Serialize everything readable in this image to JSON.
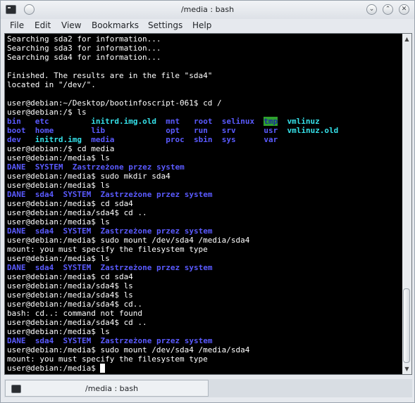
{
  "window": {
    "title": "/media : bash"
  },
  "menu": [
    "File",
    "Edit",
    "View",
    "Bookmarks",
    "Settings",
    "Help"
  ],
  "tab": {
    "label": "/media : bash"
  },
  "terminal": {
    "lines": [
      [
        {
          "t": "Searching sda2 for information..."
        }
      ],
      [
        {
          "t": "Searching sda3 for information..."
        }
      ],
      [
        {
          "t": "Searching sda4 for information..."
        }
      ],
      [
        {
          "t": ""
        }
      ],
      [
        {
          "t": "Finished. The results are in the file \"sda4\""
        }
      ],
      [
        {
          "t": "located in \"/dev/\"."
        }
      ],
      [
        {
          "t": ""
        }
      ],
      [
        {
          "t": "user@debian:~/Desktop/bootinfoscript-061$ cd /"
        }
      ],
      [
        {
          "t": "user@debian:/$ ls"
        }
      ],
      [
        {
          "t": "bin",
          "c": "blue"
        },
        {
          "t": "   "
        },
        {
          "t": "etc",
          "c": "blue"
        },
        {
          "t": "         "
        },
        {
          "t": "initrd.img.old",
          "c": "cyan"
        },
        {
          "t": "  "
        },
        {
          "t": "mnt",
          "c": "blue"
        },
        {
          "t": "   "
        },
        {
          "t": "root",
          "c": "blue"
        },
        {
          "t": "  "
        },
        {
          "t": "selinux",
          "c": "blue"
        },
        {
          "t": "  "
        },
        {
          "t": "tmp",
          "c": "tmp"
        },
        {
          "t": "  "
        },
        {
          "t": "vmlinuz",
          "c": "cyan"
        }
      ],
      [
        {
          "t": "boot",
          "c": "blue"
        },
        {
          "t": "  "
        },
        {
          "t": "home",
          "c": "blue"
        },
        {
          "t": "        "
        },
        {
          "t": "lib",
          "c": "blue"
        },
        {
          "t": "             "
        },
        {
          "t": "opt",
          "c": "blue"
        },
        {
          "t": "   "
        },
        {
          "t": "run",
          "c": "blue"
        },
        {
          "t": "   "
        },
        {
          "t": "srv",
          "c": "blue"
        },
        {
          "t": "      "
        },
        {
          "t": "usr",
          "c": "blue"
        },
        {
          "t": "  "
        },
        {
          "t": "vmlinuz.old",
          "c": "cyan"
        }
      ],
      [
        {
          "t": "dev",
          "c": "blue"
        },
        {
          "t": "   "
        },
        {
          "t": "initrd.img",
          "c": "cyan"
        },
        {
          "t": "  "
        },
        {
          "t": "media",
          "c": "blue"
        },
        {
          "t": "           "
        },
        {
          "t": "proc",
          "c": "blue"
        },
        {
          "t": "  "
        },
        {
          "t": "sbin",
          "c": "blue"
        },
        {
          "t": "  "
        },
        {
          "t": "sys",
          "c": "blue"
        },
        {
          "t": "      "
        },
        {
          "t": "var",
          "c": "blue"
        }
      ],
      [
        {
          "t": "user@debian:/$ cd media"
        }
      ],
      [
        {
          "t": "user@debian:/media$ ls"
        }
      ],
      [
        {
          "t": "DANE",
          "c": "blue"
        },
        {
          "t": "  "
        },
        {
          "t": "SYSTEM",
          "c": "blue"
        },
        {
          "t": "  "
        },
        {
          "t": "Zastrzeżone przez system",
          "c": "blue"
        }
      ],
      [
        {
          "t": "user@debian:/media$ sudo mkdir sda4"
        }
      ],
      [
        {
          "t": "user@debian:/media$ ls"
        }
      ],
      [
        {
          "t": "DANE",
          "c": "blue"
        },
        {
          "t": "  "
        },
        {
          "t": "sda4",
          "c": "blue"
        },
        {
          "t": "  "
        },
        {
          "t": "SYSTEM",
          "c": "blue"
        },
        {
          "t": "  "
        },
        {
          "t": "Zastrzeżone przez system",
          "c": "blue"
        }
      ],
      [
        {
          "t": "user@debian:/media$ cd sda4"
        }
      ],
      [
        {
          "t": "user@debian:/media/sda4$ cd .."
        }
      ],
      [
        {
          "t": "user@debian:/media$ ls"
        }
      ],
      [
        {
          "t": "DANE",
          "c": "blue"
        },
        {
          "t": "  "
        },
        {
          "t": "sda4",
          "c": "blue"
        },
        {
          "t": "  "
        },
        {
          "t": "SYSTEM",
          "c": "blue"
        },
        {
          "t": "  "
        },
        {
          "t": "Zastrzeżone przez system",
          "c": "blue"
        }
      ],
      [
        {
          "t": "user@debian:/media$ sudo mount /dev/sda4 /media/sda4"
        }
      ],
      [
        {
          "t": "mount: you must specify the filesystem type"
        }
      ],
      [
        {
          "t": "user@debian:/media$ ls"
        }
      ],
      [
        {
          "t": "DANE",
          "c": "blue"
        },
        {
          "t": "  "
        },
        {
          "t": "sda4",
          "c": "blue"
        },
        {
          "t": "  "
        },
        {
          "t": "SYSTEM",
          "c": "blue"
        },
        {
          "t": "  "
        },
        {
          "t": "Zastrzeżone przez system",
          "c": "blue"
        }
      ],
      [
        {
          "t": "user@debian:/media$ cd sda4"
        }
      ],
      [
        {
          "t": "user@debian:/media/sda4$ ls"
        }
      ],
      [
        {
          "t": "user@debian:/media/sda4$ ls"
        }
      ],
      [
        {
          "t": "user@debian:/media/sda4$ cd.."
        }
      ],
      [
        {
          "t": "bash: cd..: command not found"
        }
      ],
      [
        {
          "t": "user@debian:/media/sda4$ cd .."
        }
      ],
      [
        {
          "t": "user@debian:/media$ ls"
        }
      ],
      [
        {
          "t": "DANE",
          "c": "blue"
        },
        {
          "t": "  "
        },
        {
          "t": "sda4",
          "c": "blue"
        },
        {
          "t": "  "
        },
        {
          "t": "SYSTEM",
          "c": "blue"
        },
        {
          "t": "  "
        },
        {
          "t": "Zastrzeżone przez system",
          "c": "blue"
        }
      ],
      [
        {
          "t": "user@debian:/media$ sudo mount /dev/sda4 /media/sda4"
        }
      ],
      [
        {
          "t": "mount: you must specify the filesystem type"
        }
      ],
      [
        {
          "t": "user@debian:/media$ "
        },
        {
          "t": " ",
          "c": "cursor"
        }
      ]
    ]
  }
}
